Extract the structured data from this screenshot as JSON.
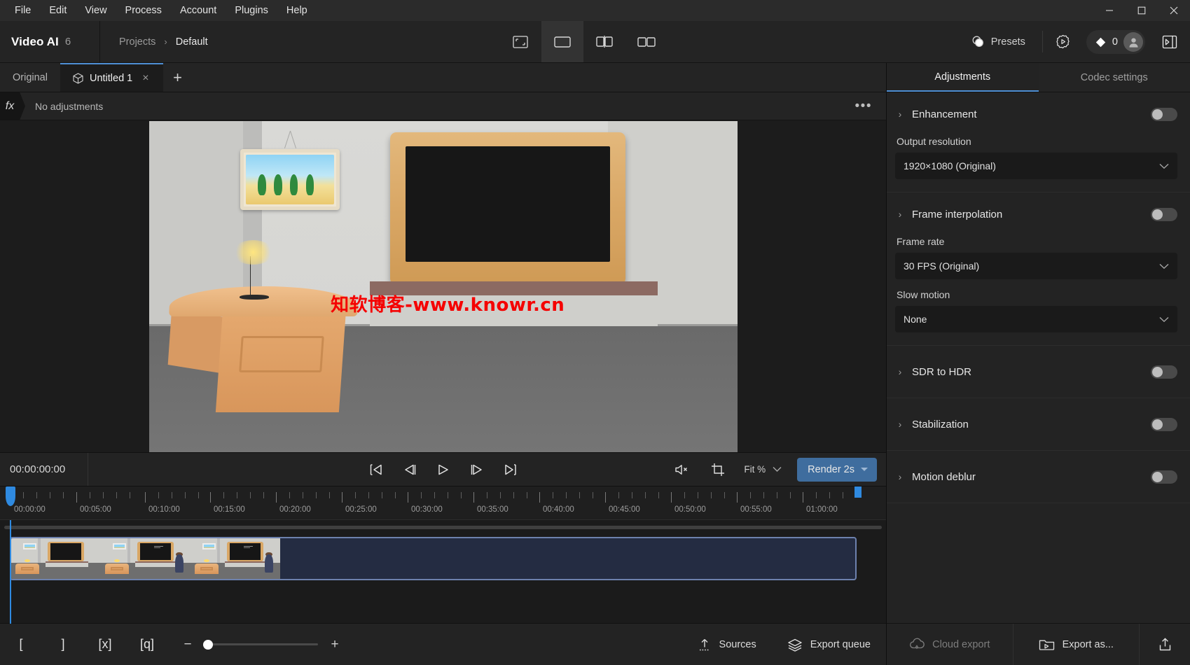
{
  "menubar": {
    "items": [
      "File",
      "Edit",
      "View",
      "Process",
      "Account",
      "Plugins",
      "Help"
    ],
    "window_controls": [
      "minimize",
      "maximize",
      "close"
    ]
  },
  "header": {
    "app_name": "Video AI",
    "app_version": "6",
    "breadcrumbs": [
      "Projects",
      "Default"
    ],
    "breadcrumb_separator": "›",
    "view_modes": [
      "fit-screen-view",
      "single-view",
      "split-view",
      "side-by-side-view"
    ],
    "selected_view_mode": "single-view",
    "presets_label": "Presets",
    "credits_count": "0"
  },
  "tabs": {
    "items": [
      {
        "label": "Original",
        "closable": false,
        "active": false
      },
      {
        "label": "Untitled 1",
        "closable": true,
        "active": true
      }
    ],
    "add_label": "+",
    "close_label": "×"
  },
  "fxbar": {
    "fx_label": "fx",
    "status": "No adjustments",
    "more_label": "•••"
  },
  "preview": {
    "watermark": "知软博客-www.knowr.cn"
  },
  "transport": {
    "timecode": "00:00:00:00",
    "buttons": [
      "skip-to-start",
      "step-back",
      "play",
      "step-forward",
      "skip-to-end"
    ],
    "mute_label": "muted",
    "crop_label": "crop",
    "zoom_fit_label": "Fit %",
    "render_label": "Render 2s"
  },
  "timeline": {
    "tick_labels": [
      "00:00:00",
      "00:05:00",
      "00:10:00",
      "00:15:00",
      "00:20:00",
      "00:25:00",
      "00:30:00",
      "00:35:00",
      "00:40:00",
      "00:45:00",
      "00:50:00",
      "00:55:00",
      "01:00:00"
    ],
    "playhead_position": "00:00:00",
    "clip_count": 1
  },
  "bottombar": {
    "in_point_label": "[",
    "out_point_label": "]",
    "clear_marks_label": "[x]",
    "zoom_to_fit_label": "[q]",
    "zoom_minus": "−",
    "zoom_plus": "+",
    "sources_label": "Sources",
    "export_queue_label": "Export queue"
  },
  "right_panel": {
    "tabs": [
      {
        "label": "Adjustments",
        "active": true
      },
      {
        "label": "Codec settings",
        "active": false
      }
    ],
    "sections": [
      {
        "title": "Enhancement",
        "enabled": false,
        "fields": [
          {
            "label": "Output resolution",
            "value": "1920×1080 (Original)"
          }
        ]
      },
      {
        "title": "Frame interpolation",
        "enabled": false,
        "fields": [
          {
            "label": "Frame rate",
            "value": "30 FPS (Original)"
          },
          {
            "label": "Slow motion",
            "value": "None"
          }
        ]
      },
      {
        "title": "SDR to HDR",
        "enabled": false,
        "fields": []
      },
      {
        "title": "Stabilization",
        "enabled": false,
        "fields": []
      },
      {
        "title": "Motion deblur",
        "enabled": false,
        "fields": []
      }
    ],
    "chevron": "›",
    "select_caret": "⌄",
    "footer": {
      "cloud_export_label": "Cloud export",
      "export_as_label": "Export as...",
      "share_label": "share"
    }
  },
  "colors": {
    "accent_blue": "#4f8fd4",
    "render_button": "#3f6d9e",
    "playhead": "#2f8ae0",
    "watermark_red": "#f50000",
    "panel_bg": "#232323",
    "canvas_bg": "#1c1c1c"
  }
}
